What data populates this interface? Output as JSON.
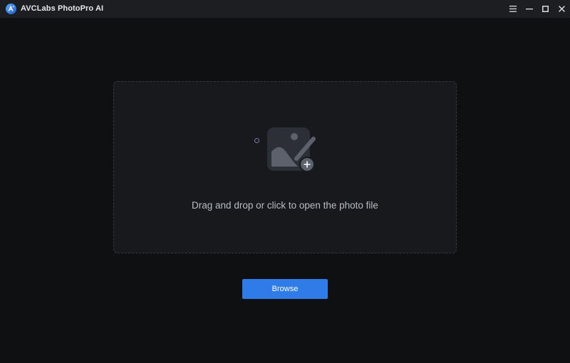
{
  "window": {
    "title": "AVCLabs PhotoPro AI",
    "logo_text": "A",
    "controls": [
      "menu-icon",
      "minimize-icon",
      "maximize-icon",
      "close-icon"
    ]
  },
  "dropzone": {
    "icon": "photo-add-icon",
    "hint": "Drag and drop or click to open the photo file"
  },
  "actions": {
    "browse_label": "Browse"
  },
  "colors": {
    "background": "#0f1012",
    "titlebar": "#1c1e22",
    "dropzone": "#18191c",
    "accent": "#2f7be8"
  }
}
